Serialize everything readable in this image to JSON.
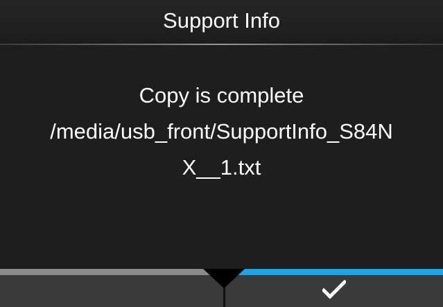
{
  "header": {
    "title": "Support Info"
  },
  "message": {
    "lines": [
      "Copy is complete",
      "/media/usb_front/SupportInfo_S84N",
      "X__1.txt"
    ]
  },
  "softkeys": {
    "left": {
      "label": "",
      "bar_color": "#8c8c8c"
    },
    "right": {
      "icon": "checkmark-icon",
      "bar_color": "#1aa3e8"
    }
  }
}
